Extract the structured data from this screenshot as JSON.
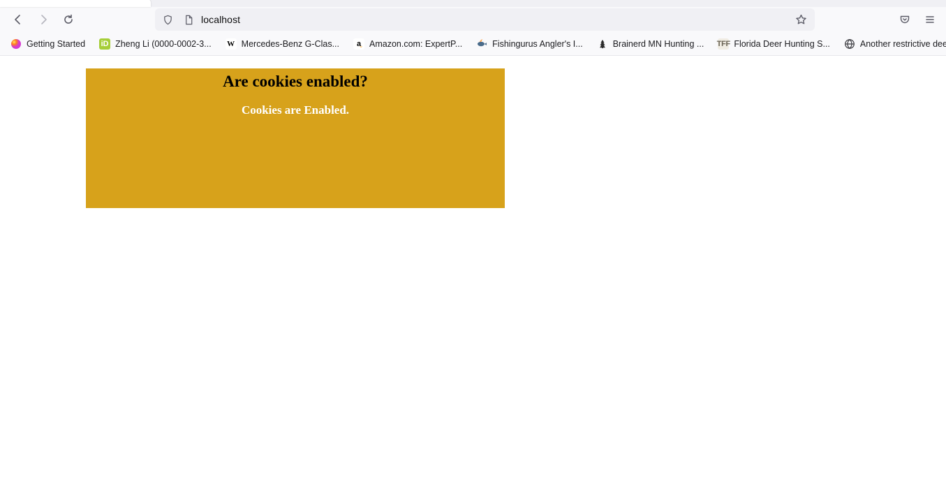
{
  "browser": {
    "url": "localhost"
  },
  "bookmarks": [
    {
      "label": "Getting Started",
      "icon": "started"
    },
    {
      "label": "Zheng Li (0000-0002-3...",
      "icon": "orcid"
    },
    {
      "label": "Mercedes-Benz G-Clas...",
      "icon": "wiki"
    },
    {
      "label": "Amazon.com: ExpertP...",
      "icon": "amzn"
    },
    {
      "label": "Fishingurus Angler's I...",
      "icon": "fish"
    },
    {
      "label": "Brainerd MN Hunting ...",
      "icon": "tree"
    },
    {
      "label": "Florida Deer Hunting S...",
      "icon": "tff"
    },
    {
      "label": "Another restrictive dee...",
      "icon": "globe"
    }
  ],
  "page": {
    "heading": "Are cookies enabled?",
    "status": "Cookies are Enabled."
  },
  "colors": {
    "card_bg": "#d7a21b",
    "chrome_bg": "#f9f9fb",
    "urlbar_bg": "#f0f0f4"
  }
}
